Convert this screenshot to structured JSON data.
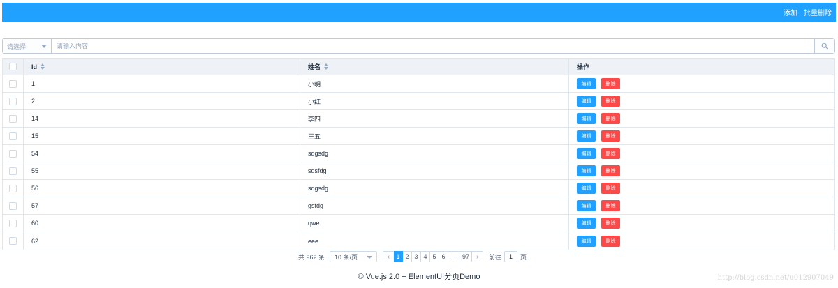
{
  "toolbar": {
    "add_label": "添加",
    "batch_delete_label": "批量删除"
  },
  "search": {
    "select_placeholder": "请选择",
    "input_placeholder": "请输入内容",
    "button_icon": "search-icon"
  },
  "table": {
    "headers": {
      "id": "Id",
      "name": "姓名",
      "ops": "操作"
    },
    "edit_label": "编辑",
    "delete_label": "删除",
    "rows": [
      {
        "id": "1",
        "name": "小明"
      },
      {
        "id": "2",
        "name": "小红"
      },
      {
        "id": "14",
        "name": "李四"
      },
      {
        "id": "15",
        "name": "王五"
      },
      {
        "id": "54",
        "name": "sdgsdg"
      },
      {
        "id": "55",
        "name": "sdsfdg"
      },
      {
        "id": "56",
        "name": "sdgsdg"
      },
      {
        "id": "57",
        "name": "gsfdg"
      },
      {
        "id": "60",
        "name": "qwe"
      },
      {
        "id": "62",
        "name": "eee"
      }
    ]
  },
  "pagination": {
    "total_text": "共 962 条",
    "page_size": "10 条/页",
    "pages": [
      "1",
      "2",
      "3",
      "4",
      "5",
      "6",
      "···",
      "97"
    ],
    "current_page": "1",
    "goto_prefix": "前往",
    "goto_value": "1",
    "goto_suffix": "页"
  },
  "footer": {
    "text": "© Vue.js 2.0 + ElementUI分页Demo",
    "watermark": "http://blog.csdn.net/u012907049"
  },
  "colors": {
    "primary": "#20a0ff",
    "danger": "#ff4949",
    "border": "#dfe6ec",
    "header_bg": "#eef1f6"
  }
}
